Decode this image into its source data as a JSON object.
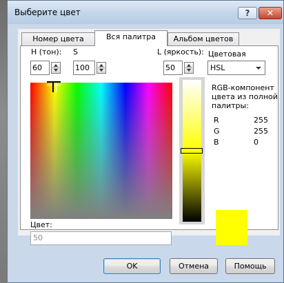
{
  "window": {
    "title": "Выберите цвет"
  },
  "tabs": [
    {
      "label": "Номер цвета",
      "active": false
    },
    {
      "label": "Вся палитра",
      "active": true
    },
    {
      "label": "Альбом цветов",
      "active": false
    }
  ],
  "hue": {
    "label": "H (тон):",
    "value": "60"
  },
  "saturation": {
    "label": "S",
    "value": "100"
  },
  "lightness": {
    "label": "L (яркость):",
    "value": "50",
    "level": 0.5
  },
  "color_model": {
    "label": "Цветовая",
    "selected": "HSL"
  },
  "rgb": {
    "caption_line1": "RGB-компонент",
    "caption_line2": "цвета из полной",
    "caption_line3": "палитры:",
    "rows": [
      {
        "name": "R",
        "value": "255"
      },
      {
        "name": "G",
        "value": "255"
      },
      {
        "name": "B",
        "value": "0"
      }
    ]
  },
  "color_field": {
    "label": "Цвет:",
    "value": "50"
  },
  "preview_color": "#ffff00",
  "buttons": {
    "ok": "OK",
    "cancel": "Отмена",
    "help": "Помощь"
  },
  "icons": {
    "help": "question-icon",
    "close": "close-icon"
  }
}
